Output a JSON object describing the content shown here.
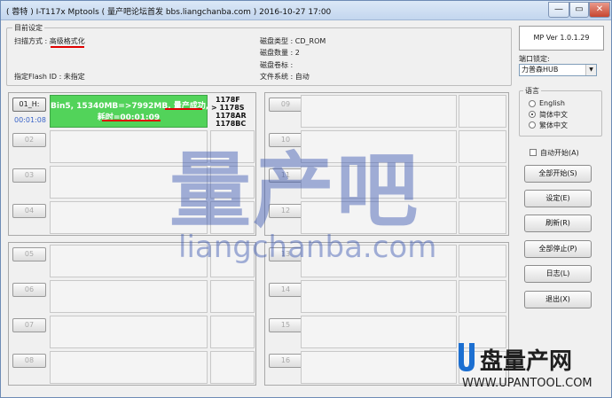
{
  "window": {
    "title": "( 蓉特 ) I-T117x Mptools ( 量产吧论坛首发 bbs.liangchanba.com )      2016-10-27 17:00",
    "min": "—",
    "max": "▭",
    "close": "✕"
  },
  "settings": {
    "legend": "目前设定",
    "scan_mode": "扫描方式 : 高级格式化",
    "flash_id": "指定Flash ID : 未指定",
    "disk_type": "磁盘类型 : CD_ROM",
    "disk_count": "磁盘数量 : 2",
    "disk_label": "磁盘卷标 :",
    "filesystem": "文件系统 : 自动"
  },
  "version": "MP Ver 1.0.1.29",
  "port_lock": {
    "label": "端口锁定:",
    "value": "力普森HUB",
    "arrow": "▼"
  },
  "language": {
    "legend": "语言",
    "options": [
      {
        "label": "English",
        "selected": false
      },
      {
        "label": "简体中文",
        "selected": true
      },
      {
        "label": "繁体中文",
        "selected": false
      }
    ]
  },
  "autostart": {
    "label": "自动开始(A)",
    "checked": false
  },
  "buttons": [
    "全部开始(S)",
    "设定(E)",
    "刷新(R)",
    "全部停止(P)",
    "日志(L)",
    "退出(X)"
  ],
  "ports": [
    {
      "label": "01_H:",
      "timer": "00:01:08",
      "result1": "Bin5, 15340MB=>7992MB, 量产成功,",
      "result2": "耗时=00:01:09",
      "codes": [
        "1178F",
        "> 1178S",
        "1178AR",
        "1178BC"
      ]
    },
    {
      "label": "02"
    },
    {
      "label": "03"
    },
    {
      "label": "04"
    },
    {
      "label": "05"
    },
    {
      "label": "06"
    },
    {
      "label": "07"
    },
    {
      "label": "08"
    },
    {
      "label": "09"
    },
    {
      "label": "10"
    },
    {
      "label": "11"
    },
    {
      "label": "12"
    },
    {
      "label": "13"
    },
    {
      "label": "14"
    },
    {
      "label": "15"
    },
    {
      "label": "16"
    }
  ],
  "watermark": {
    "big": "量产吧",
    "url": "liangchanba.com"
  },
  "logo": {
    "text": "盘量产网",
    "url": "WWW.UPANTOOL.COM"
  }
}
